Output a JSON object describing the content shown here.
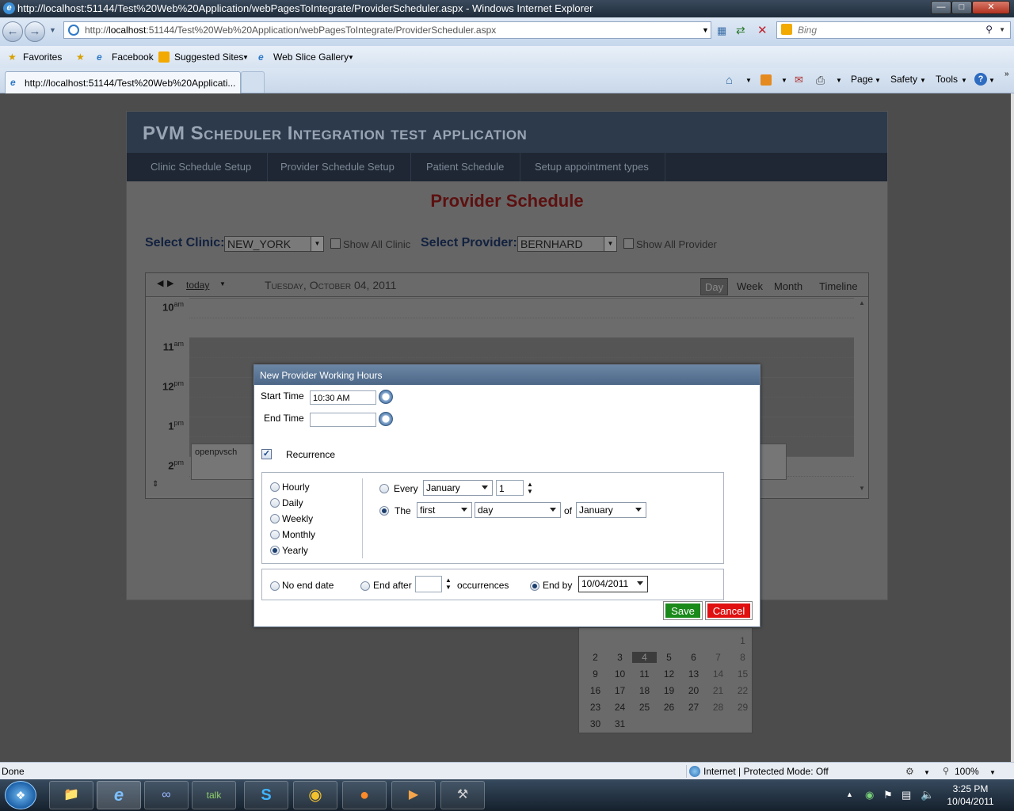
{
  "browser": {
    "window_title": "http://localhost:51144/Test%20Web%20Application/webPagesToIntegrate/ProviderScheduler.aspx - Windows Internet Explorer",
    "url_prefix": "http://",
    "url_host": "localhost",
    "url_rest": ":51144/Test%20Web%20Application/webPagesToIntegrate/ProviderScheduler.aspx",
    "search_placeholder": "Bing",
    "favorites": [
      "Favorites",
      "Facebook",
      "Suggested Sites",
      "Web Slice Gallery"
    ],
    "tab_title": "http://localhost:51144/Test%20Web%20Applicati...",
    "commands": [
      "Page",
      "Safety",
      "Tools"
    ]
  },
  "app": {
    "title": "PVM Scheduler Integration test application",
    "nav": [
      "Clinic Schedule Setup",
      "Provider Schedule Setup",
      "Patient Schedule",
      "Setup appointment types"
    ],
    "page_title": "Provider Schedule",
    "select_clinic_label": "Select Clinic:",
    "clinic_value": "NEW_YORK",
    "show_all_clinic": "Show All Clinic",
    "select_provider_label": "Select Provider:",
    "provider_value": "BERNHARD",
    "show_all_provider": "Show All Provider"
  },
  "scheduler": {
    "today": "today",
    "date": "Tuesday, October 04, 2011",
    "views": [
      "Day",
      "Week",
      "Month",
      "Timeline"
    ],
    "active_view": "Day",
    "hours": [
      {
        "h": "10",
        "ap": "am"
      },
      {
        "h": "11",
        "ap": "am"
      },
      {
        "h": "12",
        "ap": "pm"
      },
      {
        "h": "1",
        "ap": "pm"
      },
      {
        "h": "2",
        "ap": "pm"
      }
    ],
    "appointment": "openpvsch"
  },
  "calendar": {
    "rows": [
      [
        "",
        "",
        "",
        "",
        "",
        "",
        "1"
      ],
      [
        "2",
        "3",
        "4",
        "5",
        "6",
        "7",
        "8"
      ],
      [
        "9",
        "10",
        "11",
        "12",
        "13",
        "14",
        "15"
      ],
      [
        "16",
        "17",
        "18",
        "19",
        "20",
        "21",
        "22"
      ],
      [
        "23",
        "24",
        "25",
        "26",
        "27",
        "28",
        "29"
      ],
      [
        "30",
        "31",
        "",
        "",
        "",
        "",
        ""
      ]
    ],
    "selected": "4"
  },
  "dialog": {
    "title": "New Provider Working Hours",
    "start_time_label": "Start Time",
    "start_time_value": "10:30 AM",
    "end_time_label": "End Time",
    "end_time_value": "",
    "recurrence_label": "Recurrence",
    "recurrence_checked": true,
    "frequencies": [
      "Hourly",
      "Daily",
      "Weekly",
      "Monthly",
      "Yearly"
    ],
    "selected_frequency": "Yearly",
    "every_label": "Every",
    "every_month": "January",
    "every_day": "1",
    "the_label": "The",
    "the_ordinal": "first",
    "the_day": "day",
    "of_label": "of",
    "the_month": "January",
    "no_end_label": "No end date",
    "end_after_label": "End after",
    "end_after_value": "",
    "occurrences_label": "occurrences",
    "end_by_label": "End by",
    "end_by_value": "10/04/2011",
    "save": "Save",
    "cancel": "Cancel",
    "colors": {
      "save": "#1a8a1a",
      "cancel": "#e01010"
    }
  },
  "status": {
    "left": "Done",
    "zone": "Internet | Protected Mode: Off",
    "zoom": "100%"
  },
  "taskbar": {
    "time": "3:25 PM",
    "date": "10/04/2011"
  }
}
